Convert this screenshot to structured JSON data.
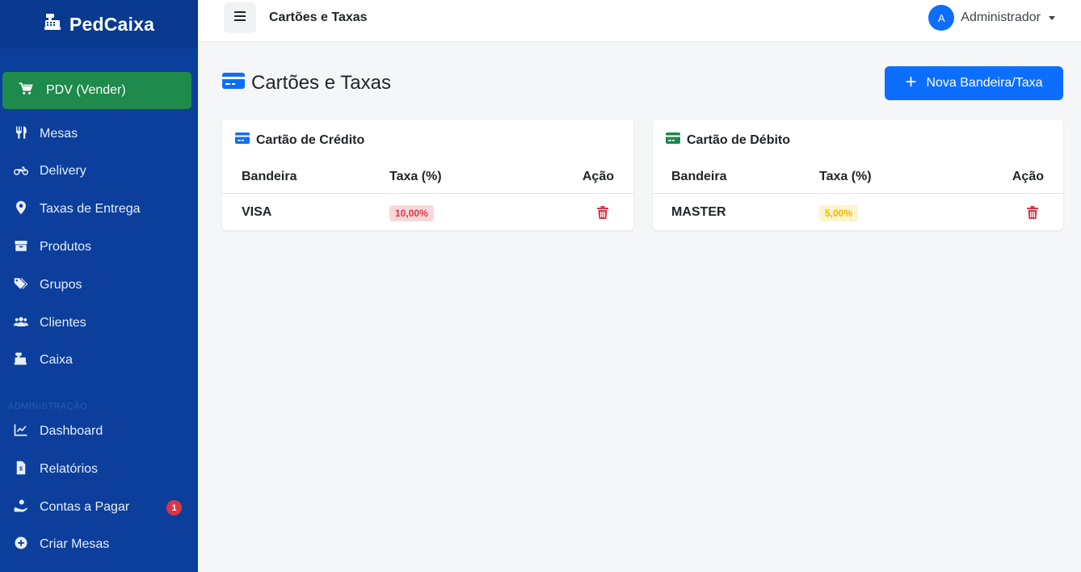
{
  "brand": {
    "name": "PedCaixa"
  },
  "sidebar": {
    "pdv_label": "PDV (Vender)",
    "items": [
      {
        "label": "Mesas"
      },
      {
        "label": "Delivery"
      },
      {
        "label": "Taxas de Entrega"
      },
      {
        "label": "Produtos"
      },
      {
        "label": "Grupos"
      },
      {
        "label": "Clientes"
      },
      {
        "label": "Caixa"
      }
    ],
    "section_admin": "ADMINISTRAÇÃO",
    "admin_items": [
      {
        "label": "Dashboard"
      },
      {
        "label": "Relatórios"
      },
      {
        "label": "Contas a Pagar",
        "badge": "1"
      },
      {
        "label": "Criar Mesas"
      }
    ]
  },
  "topbar": {
    "title": "Cartões e Taxas",
    "user": {
      "initial": "A",
      "name": "Administrador"
    }
  },
  "main": {
    "title": "Cartões e Taxas",
    "new_button": "Nova Bandeira/Taxa",
    "cards": [
      {
        "title": "Cartão de Crédito",
        "icon_color": "#0d6efd",
        "columns": [
          "Bandeira",
          "Taxa (%)",
          "Ação"
        ],
        "rows": [
          {
            "brand": "VISA",
            "rate": "10,00%"
          }
        ]
      },
      {
        "title": "Cartão de Débito",
        "icon_color": "#1e8a4c",
        "columns": [
          "Bandeira",
          "Taxa (%)",
          "Ação"
        ],
        "rows": [
          {
            "brand": "MASTER",
            "rate": "5,00%"
          }
        ]
      }
    ]
  },
  "colors": {
    "sidebar": "#0b3f9b",
    "primary": "#0d6efd",
    "success": "#1e8a4c",
    "danger": "#dc3545"
  }
}
